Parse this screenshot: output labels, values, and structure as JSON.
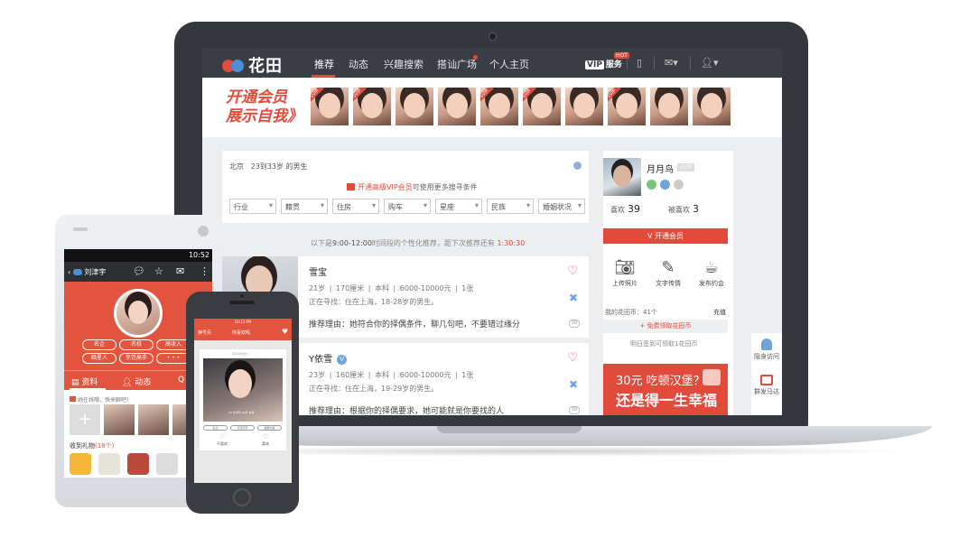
{
  "laptop": {
    "nav": {
      "logo": "花田",
      "items": [
        "推荐",
        "动态",
        "兴趣搜索",
        "搭讪广场",
        "个人主页"
      ],
      "vip_label": "VIP",
      "vip_service": "服务",
      "hot": "HOT",
      "icons": [
        "phone-icon",
        "mail-icon",
        "user-icon"
      ]
    },
    "banner": {
      "line1": "开通会员",
      "line2": "展示自我》",
      "badge": "SVIP"
    },
    "filter": {
      "city": "北京",
      "criteria": "23到33岁 的男生",
      "vip_link": "开通高级VIP会员",
      "vip_suffix": "可使用更多搜寻条件",
      "selects": [
        "行业",
        "籍贯",
        "住房",
        "购车",
        "星座",
        "民族",
        "婚姻状况"
      ]
    },
    "hint": {
      "prefix": "以下是",
      "time": "9:00-12:00",
      "mid": "时间段的个性化推荐，距下次推荐还有",
      "countdown": "1:30:30"
    },
    "users": [
      {
        "name": "雪宝",
        "info": "21岁 | 170厘米 | 本科 | 6000-10000元 | 1张",
        "seeking": "正在寻找：住在上海，18-28岁的男生。",
        "reason": "推荐理由：她符合你的择偶条件，聊几句吧，不要错过缘分",
        "link_label": "3D"
      },
      {
        "name": "Y依雪",
        "verify": "V",
        "info": "23岁 | 160厘米 | 本科 | 6000-10000元 | 1张",
        "seeking": "正在寻找：住在上海，19-29岁的男生。",
        "reason": "推荐理由：根据你的择偶要求，她可能就是你要找的人",
        "link_label": "3D"
      }
    ],
    "profile": {
      "name": "月月鸟",
      "badge": "SVIP",
      "likes_label": "喜欢",
      "likes": "39",
      "liked_label": "被喜欢",
      "liked": "3",
      "open_vip": "开通会员",
      "actions": [
        {
          "icon": "camera-icon",
          "label": "上传照片"
        },
        {
          "icon": "edit-icon",
          "label": "文字传情"
        },
        {
          "icon": "cup-icon",
          "label": "发布约会"
        }
      ],
      "coins": "我的花田币：41个",
      "recharge": "充值",
      "free_coins": "+ 免费领取花田币",
      "signin": "明日签到可领取1花田币",
      "ad_line1": "30元 吃顿汉堡？",
      "ad_line2": "还是得一生幸福"
    },
    "side": {
      "item1": "隐身访问",
      "item2": "群发马达"
    }
  },
  "android": {
    "time": "10:52",
    "title": "刘津宇",
    "tags": [
      "名企",
      "名校",
      "高收入",
      "暗星人",
      "烹饪高手",
      "• • •"
    ],
    "tabs": [
      "资料",
      "动态",
      "Q"
    ],
    "notice": "她在线哦，快来聊吧！",
    "gifts_title": "收到礼物",
    "gifts_count": "(18个)",
    "add": "+"
  },
  "iphone": {
    "status": "10:13 PM",
    "left": "换号页",
    "title": "你喜欢吗",
    "tip": "滑动浏览缘分",
    "card_name": "25 刘津宇 24岁 本科",
    "tags": [
      "名企",
      "烹饪高手",
      "超能创造"
    ],
    "actions": [
      {
        "icon": "heart-outline-icon",
        "label": "不喜欢"
      },
      {
        "icon": "heart-icon",
        "label": "喜欢"
      }
    ]
  },
  "colors": {
    "accent": "#e24a3b",
    "nav_bg": "#3a3d44",
    "blue": "#6fa3d9"
  }
}
